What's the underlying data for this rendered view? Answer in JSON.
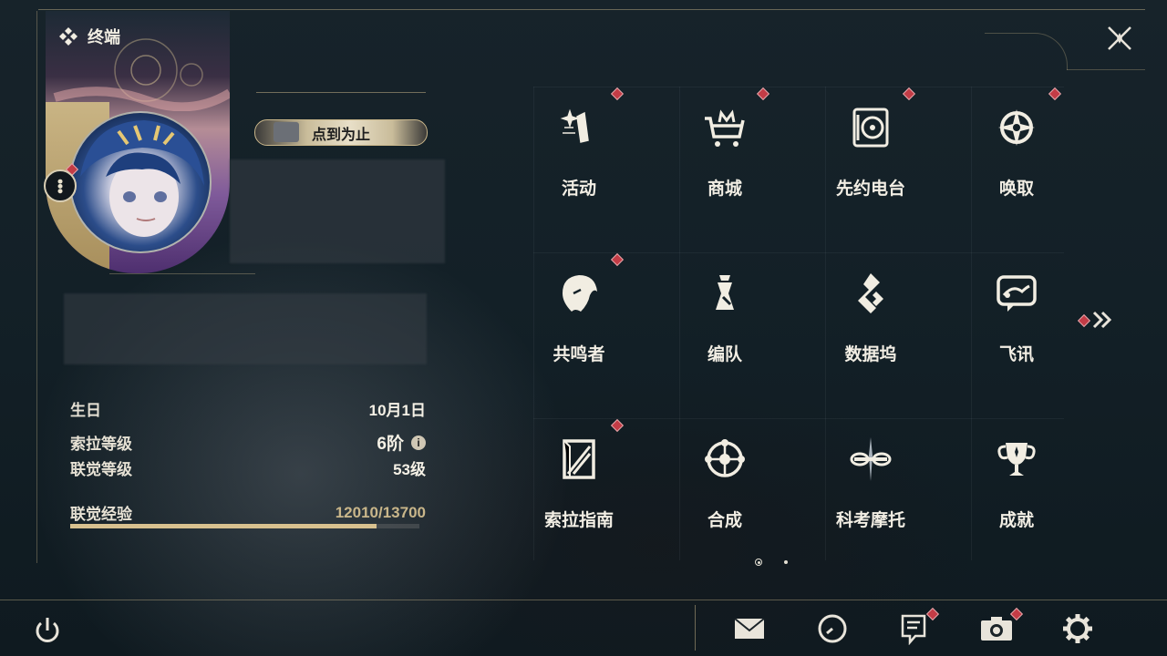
{
  "header": {
    "terminal_title": "终端",
    "close_icon": "close-x-icon"
  },
  "profile": {
    "title_label": "点到为止",
    "birthday_label": "生日",
    "birthday_value": "10月1日",
    "sol_level_label": "索拉等级",
    "sol_level_value": "6阶",
    "union_level_label": "联觉等级",
    "union_level_value": "53级",
    "union_exp_label": "联觉经验",
    "union_exp_value": "12010/13700",
    "union_exp_progress": 0.877
  },
  "menu": {
    "items": [
      {
        "label": "活动",
        "icon": "events-icon",
        "badge": true
      },
      {
        "label": "商城",
        "icon": "shop-cart-icon",
        "badge": true
      },
      {
        "label": "先约电台",
        "icon": "radio-icon",
        "badge": true
      },
      {
        "label": "唤取",
        "icon": "summon-compass-icon",
        "badge": true
      },
      {
        "label": "共鸣者",
        "icon": "resonator-icon",
        "badge": true
      },
      {
        "label": "编队",
        "icon": "team-chess-icon",
        "badge": false
      },
      {
        "label": "数据坞",
        "icon": "data-dock-icon",
        "badge": false
      },
      {
        "label": "飞讯",
        "icon": "chat-icon",
        "badge": false
      },
      {
        "label": "索拉指南",
        "icon": "guide-book-icon",
        "badge": true
      },
      {
        "label": "合成",
        "icon": "synthesis-icon",
        "badge": false
      },
      {
        "label": "科考摩托",
        "icon": "motorbike-icon",
        "badge": false
      },
      {
        "label": "成就",
        "icon": "trophy-icon",
        "badge": false
      }
    ],
    "page_current": 1,
    "page_total": 2
  },
  "bottom_bar": {
    "icons": [
      "power-icon",
      "mail-icon",
      "clock-icon",
      "notes-icon",
      "camera-icon",
      "settings-gear-icon"
    ]
  },
  "colors": {
    "accent_gold": "#d8c18f",
    "badge_red": "#c33c46",
    "text": "#f2eee4"
  }
}
